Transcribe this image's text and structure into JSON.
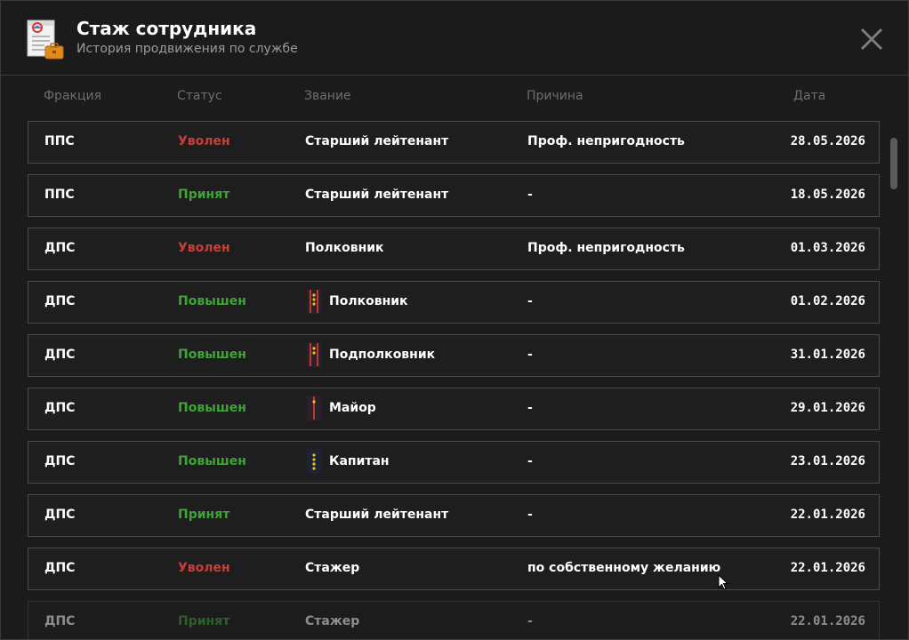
{
  "header": {
    "title": "Стаж сотрудника",
    "subtitle": "История продвижения по службе",
    "icon": "service-record-icon",
    "close_icon": "close-icon"
  },
  "columns": {
    "faction": "Фракция",
    "status": "Статус",
    "rank": "Звание",
    "reason": "Причина",
    "date": "Дата"
  },
  "status_colors": {
    "dismissed": "#c4413a",
    "hired": "#3fa33a",
    "promoted": "#3fa33a"
  },
  "rows": [
    {
      "faction": "ППС",
      "status": "Уволен",
      "status_type": "dismissed",
      "rank": "Старший лейтенант",
      "badge": "",
      "reason": "Проф. непригодность",
      "date": "28.05.2026"
    },
    {
      "faction": "ППС",
      "status": "Принят",
      "status_type": "hired",
      "rank": "Старший лейтенант",
      "badge": "",
      "reason": "-",
      "date": "18.05.2026"
    },
    {
      "faction": "ДПС",
      "status": "Уволен",
      "status_type": "dismissed",
      "rank": "Полковник",
      "badge": "",
      "reason": "Проф. непригодность",
      "date": "01.03.2026"
    },
    {
      "faction": "ДПС",
      "status": "Повышен",
      "status_type": "promoted",
      "rank": "Полковник",
      "badge": "colonel-insignia-icon",
      "reason": "-",
      "date": "01.02.2026"
    },
    {
      "faction": "ДПС",
      "status": "Повышен",
      "status_type": "promoted",
      "rank": "Подполковник",
      "badge": "lieutenant-colonel-insignia-icon",
      "reason": "-",
      "date": "31.01.2026"
    },
    {
      "faction": "ДПС",
      "status": "Повышен",
      "status_type": "promoted",
      "rank": "Майор",
      "badge": "major-insignia-icon",
      "reason": "-",
      "date": "29.01.2026"
    },
    {
      "faction": "ДПС",
      "status": "Повышен",
      "status_type": "promoted",
      "rank": "Капитан",
      "badge": "captain-insignia-icon",
      "reason": "-",
      "date": "23.01.2026"
    },
    {
      "faction": "ДПС",
      "status": "Принят",
      "status_type": "hired",
      "rank": "Старший лейтенант",
      "badge": "",
      "reason": "-",
      "date": "22.01.2026"
    },
    {
      "faction": "ДПС",
      "status": "Уволен",
      "status_type": "dismissed",
      "rank": "Стажер",
      "badge": "",
      "reason": "по собственному желанию",
      "date": "22.01.2026"
    },
    {
      "faction": "ДПС",
      "status": "Принят",
      "status_type": "hired",
      "rank": "Стажер",
      "badge": "",
      "reason": "-",
      "date": "22.01.2026"
    }
  ]
}
